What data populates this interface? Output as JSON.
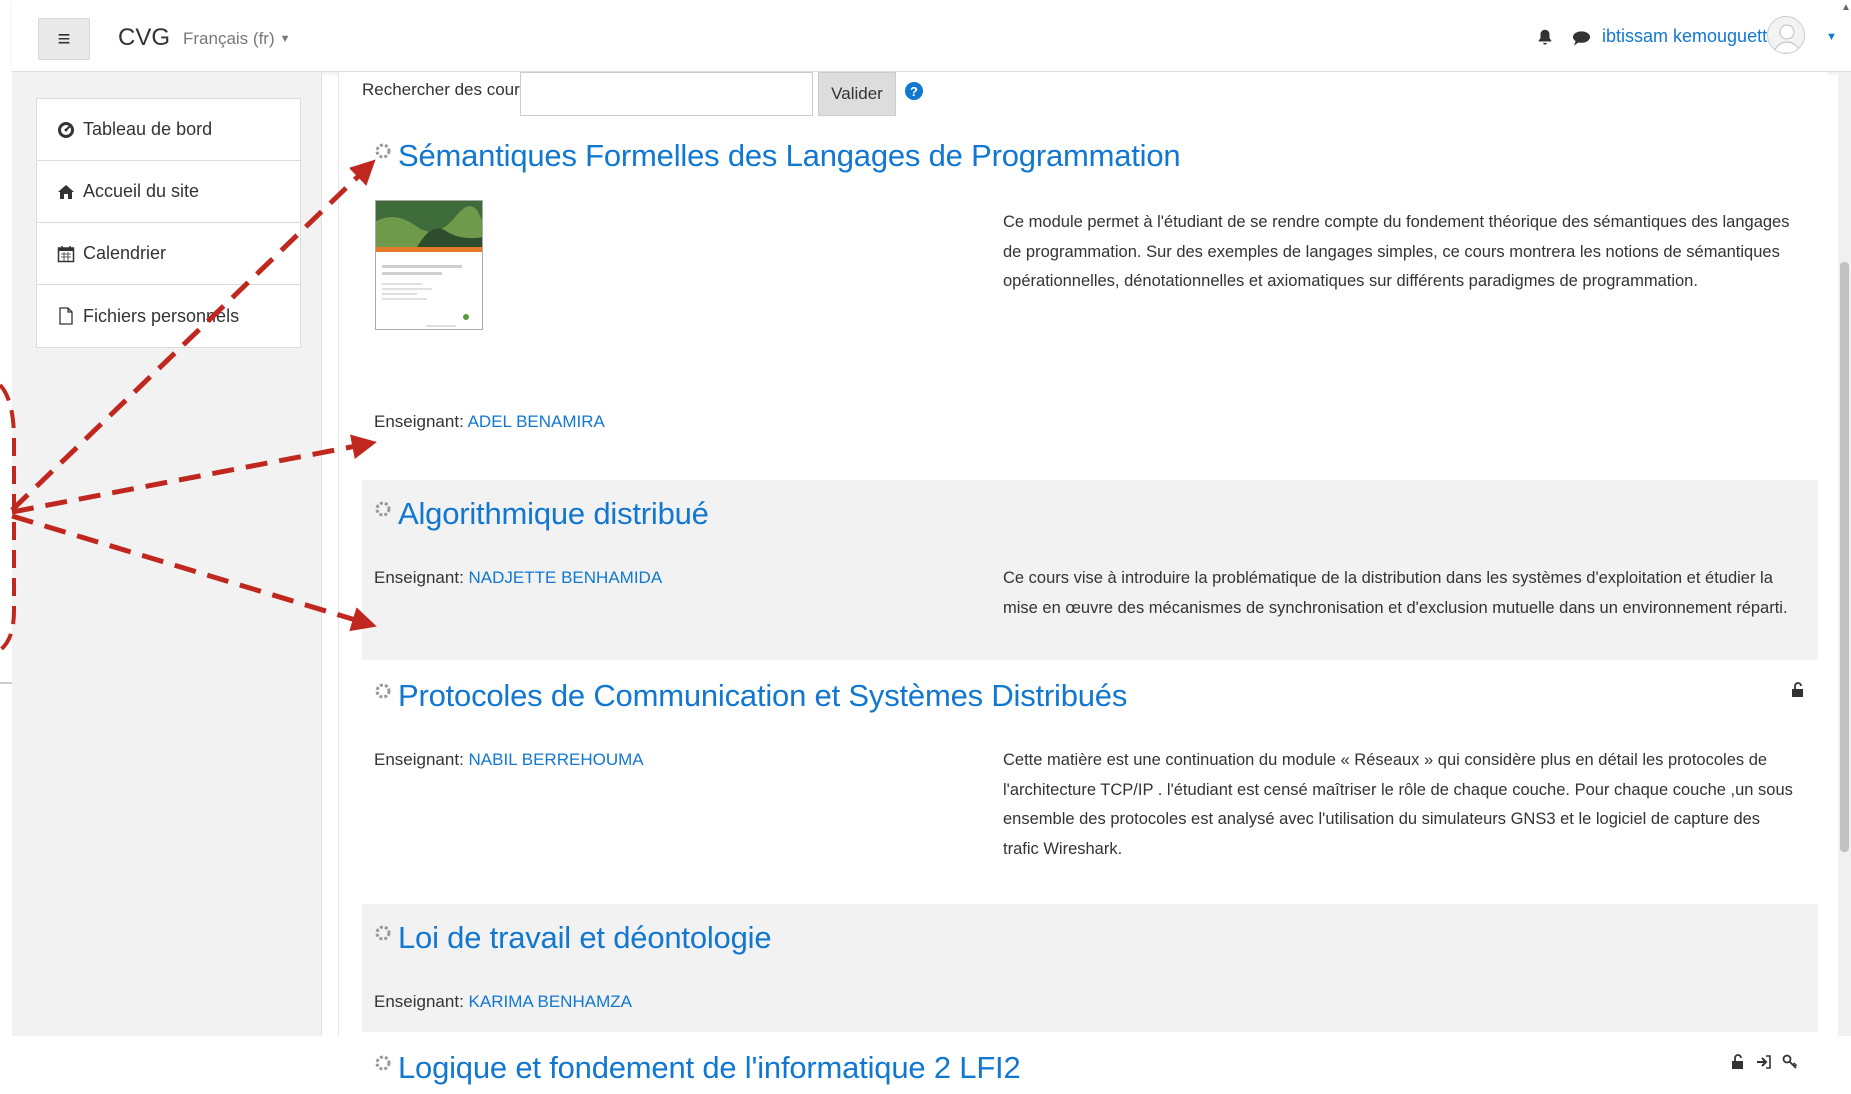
{
  "navbar": {
    "menu_icon": "hamburger-icon",
    "site_name": "CVG",
    "language": "Français (fr)",
    "notifications_icon": "bell-icon",
    "messages_icon": "chat-bubble-icon",
    "user_name": "ibtissam kemouguette"
  },
  "sidebar": {
    "items": [
      {
        "label": "Tableau de bord",
        "icon": "dashboard-icon"
      },
      {
        "label": "Accueil du site",
        "icon": "home-icon"
      },
      {
        "label": "Calendrier",
        "icon": "calendar-icon"
      },
      {
        "label": "Fichiers personnels",
        "icon": "file-icon"
      }
    ]
  },
  "search": {
    "label": "Rechercher des cours",
    "value": "",
    "button": "Valider",
    "help_icon": "?"
  },
  "courses": [
    {
      "title": "Sémantiques Formelles des Langages de Programmation",
      "teacher_label": "Enseignant:",
      "teacher": "ADEL BENAMIRA",
      "summary": "Ce module permet à l'étudiant de se rendre compte du fondement théorique des sémantiques des langages de programmation. Sur des exemples de langages simples, ce cours montrera les notions de sémantiques opérationnelles, dénotationnelles et axiomatiques sur différents paradigmes de programmation."
    },
    {
      "title": "Algorithmique distribué",
      "teacher_label": "Enseignant:",
      "teacher": "NADJETTE BENHAMIDA",
      "summary": "Ce cours vise à introduire la problématique de la distribution dans les systèmes d'exploitation et étudier la mise en œuvre des mécanismes de synchronisation et d'exclusion mutuelle dans un environnement réparti."
    },
    {
      "title": "Protocoles de Communication et Systèmes Distribués",
      "teacher_label": "Enseignant:",
      "teacher": "NABIL BERREHOUMA",
      "summary": "Cette matière est une continuation du module « Réseaux » qui considère plus en détail les protocoles de l'architecture TCP/IP . l'étudiant est censé maîtriser le rôle de chaque couche. Pour chaque couche ,un sous ensemble des protocoles est analysé avec l'utilisation du simulateurs GNS3 et le logiciel de capture des trafic Wireshark."
    },
    {
      "title": "Loi de travail et déontologie",
      "teacher_label": "Enseignant:",
      "teacher": "KARIMA BENHAMZA",
      "summary": ""
    },
    {
      "title": "Logique et fondement de l'informatique 2 LFI2",
      "teacher_label": "",
      "teacher": "",
      "summary": ""
    }
  ],
  "colors": {
    "link": "#1177d1",
    "annotation": "#c0271e",
    "alt_row": "#f2f2f2"
  }
}
